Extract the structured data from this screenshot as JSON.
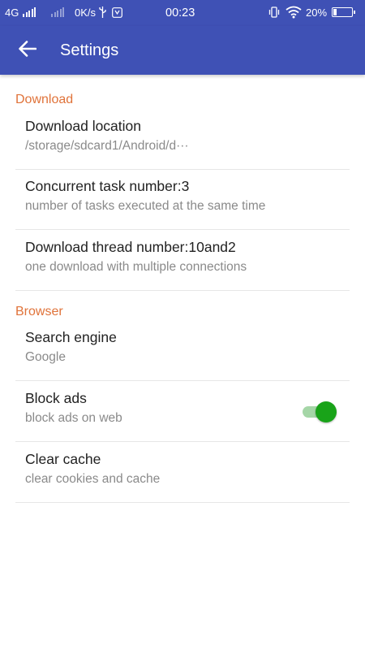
{
  "status_bar": {
    "network": "4G",
    "speed": "0K/s",
    "time": "00:23",
    "battery_percent": "20%",
    "battery_level": 0.2
  },
  "app_bar": {
    "title": "Settings"
  },
  "sections": {
    "download": {
      "header": "Download",
      "items": [
        {
          "title": "Download location",
          "summary": "/storage/sdcard1/Android/d···"
        },
        {
          "title": "Concurrent task number:3",
          "summary": "number of tasks executed at the same time"
        },
        {
          "title": "Download thread number:10and2",
          "summary": "one download with multiple connections"
        }
      ]
    },
    "browser": {
      "header": "Browser",
      "items": [
        {
          "title": "Search engine",
          "summary": "Google"
        },
        {
          "title": "Block ads",
          "summary": "block ads on web",
          "enabled": true
        },
        {
          "title": "Clear cache",
          "summary": "clear cookies and cache"
        }
      ]
    }
  },
  "colors": {
    "primary": "#3f51b5",
    "accent": "#e0733a",
    "toggle_on": "#19a319"
  }
}
